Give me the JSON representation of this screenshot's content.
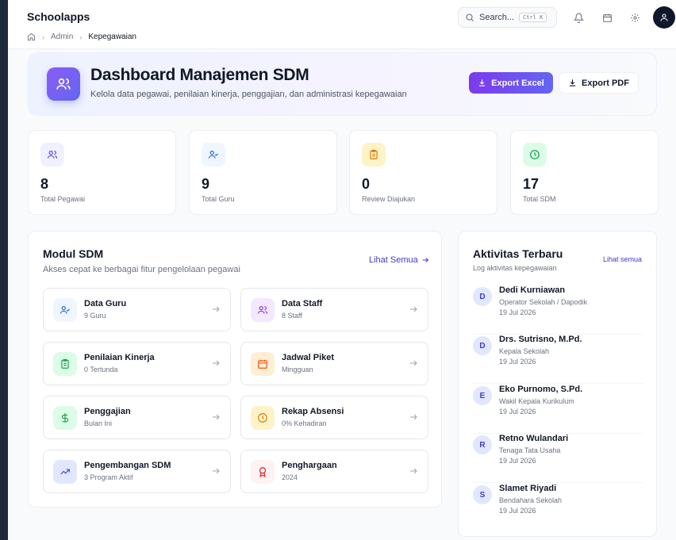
{
  "app": {
    "title": "Schoolapps"
  },
  "breadcrumb": {
    "home_icon": "home-icon",
    "items": [
      "Admin",
      "Kepegawaian"
    ]
  },
  "search": {
    "label": "Search...",
    "shortcut": "Ctrl K"
  },
  "header_icons": [
    "bell-icon",
    "calendar-icon",
    "gear-icon",
    "user-icon"
  ],
  "hero": {
    "title": "Dashboard Manajemen SDM",
    "subtitle": "Kelola data pegawai, penilaian kinerja, penggajian, dan administrasi kepegawaian",
    "export_excel": "Export Excel",
    "export_pdf": "Export PDF"
  },
  "stats": [
    {
      "value": "8",
      "label": "Total Pegawai",
      "icon": "users-icon",
      "color": "#4f46e5"
    },
    {
      "value": "9",
      "label": "Total Guru",
      "icon": "user-check-icon",
      "color": "#2563eb"
    },
    {
      "value": "0",
      "label": "Review Diajukan",
      "icon": "clipboard-icon",
      "color": "#d97706"
    },
    {
      "value": "17",
      "label": "Total SDM",
      "icon": "clock-icon",
      "color": "#16a34a"
    }
  ],
  "modul": {
    "title": "Modul SDM",
    "subtitle": "Akses cepat ke berbagai fitur pengelolaan pegawai",
    "see_all": "Lihat Semua",
    "tiles": [
      {
        "name": "Data Guru",
        "meta": "9 Guru",
        "icon": "user-check-icon",
        "color": "#2563eb"
      },
      {
        "name": "Data Staff",
        "meta": "8 Staff",
        "icon": "users-icon",
        "color": "#9333ea"
      },
      {
        "name": "Penilaian Kinerja",
        "meta": "0 Tertunda",
        "icon": "clipboard-icon",
        "color": "#16a34a"
      },
      {
        "name": "Jadwal Piket",
        "meta": "Mingguan",
        "icon": "calendar-icon",
        "color": "#ea580c"
      },
      {
        "name": "Penggajian",
        "meta": "Bulan Ini",
        "icon": "dollar-icon",
        "color": "#16a34a"
      },
      {
        "name": "Rekap Absensi",
        "meta": "0% Kehadiran",
        "icon": "clock-icon",
        "color": "#d97706"
      },
      {
        "name": "Pengembangan SDM",
        "meta": "3 Program Aktif",
        "icon": "trending-up-icon",
        "color": "#4f46e5"
      },
      {
        "name": "Penghargaan",
        "meta": "2024",
        "icon": "award-icon",
        "color": "#dc2626"
      }
    ]
  },
  "activity": {
    "title": "Aktivitas Terbaru",
    "subtitle": "Log aktivitas kepegawaian",
    "see_all": "Lihat semua",
    "items": [
      {
        "initial": "D",
        "name": "Dedi Kurniawan",
        "role": "Operator Sekolah / Dapodik",
        "date": "19 Jul 2026"
      },
      {
        "initial": "D",
        "name": "Drs. Sutrisno, M.Pd.",
        "role": "Kepala Sekolah",
        "date": "19 Jul 2026"
      },
      {
        "initial": "E",
        "name": "Eko Purnomo, S.Pd.",
        "role": "Wakil Kepala Kurikulum",
        "date": "19 Jul 2026"
      },
      {
        "initial": "R",
        "name": "Retno Wulandari",
        "role": "Tenaga Tata Usaha",
        "date": "19 Jul 2026"
      },
      {
        "initial": "S",
        "name": "Slamet Riyadi",
        "role": "Bendahara Sekolah",
        "date": "19 Jul 2026"
      }
    ]
  }
}
